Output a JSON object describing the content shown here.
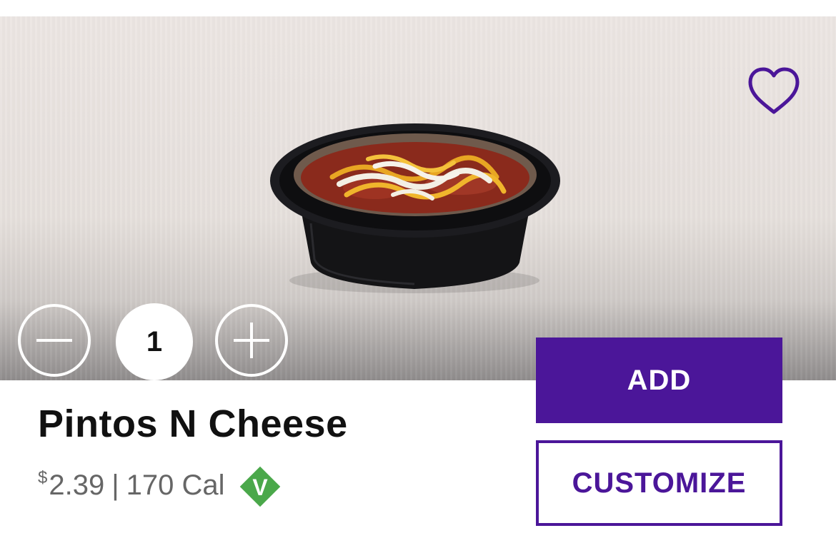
{
  "product": {
    "name": "Pintos N Cheese",
    "currency_symbol": "$",
    "price": "2.39",
    "separator": "|",
    "calories": "170 Cal",
    "badge_letter": "V"
  },
  "quantity": {
    "value": "1",
    "minus_icon": "minus-icon",
    "plus_icon": "plus-icon"
  },
  "actions": {
    "add_label": "ADD",
    "customize_label": "CUSTOMIZE"
  },
  "colors": {
    "brand_purple": "#4b1699",
    "veg_badge_green": "#4aa84a"
  }
}
